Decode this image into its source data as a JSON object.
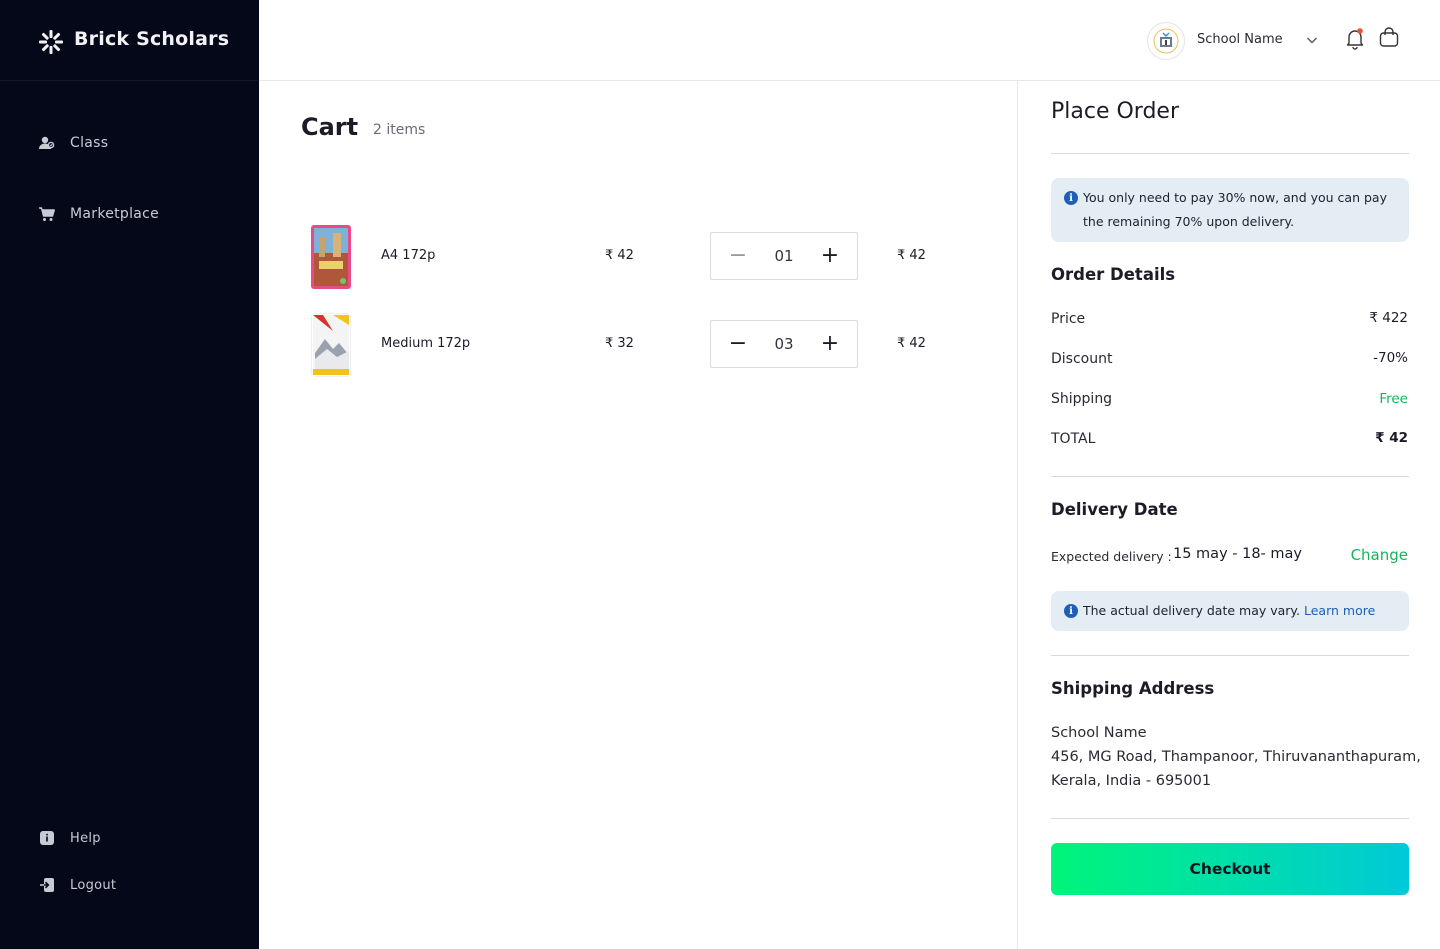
{
  "brand": {
    "name": "Brick Scholars"
  },
  "sidebar": {
    "items": [
      {
        "label": "Class",
        "icon": "users-icon"
      },
      {
        "label": "Marketplace",
        "icon": "cart-icon"
      }
    ],
    "bottom": [
      {
        "label": "Help",
        "icon": "info-icon"
      },
      {
        "label": "Logout",
        "icon": "logout-icon"
      }
    ]
  },
  "header": {
    "school_name": "School Name"
  },
  "cart": {
    "title": "Cart",
    "count_label": "2 items",
    "items": [
      {
        "name": "A4 172p",
        "price": "₹ 42",
        "qty": "01",
        "total": "₹ 42"
      },
      {
        "name": "Medium 172p",
        "price": "₹ 32",
        "qty": "03",
        "total": "₹ 42"
      }
    ]
  },
  "order": {
    "title": "Place Order",
    "pay_note": "You only need to pay 30% now, and you can pay the remaining 70% upon delivery.",
    "details_title": "Order Details",
    "price_label": "Price",
    "price_value": "₹ 422",
    "discount_label": "Discount",
    "discount_value": "-70%",
    "shipping_label": "Shipping",
    "shipping_value": "Free",
    "total_label": "TOTAL",
    "total_value": "₹ 42",
    "delivery_title": "Delivery Date",
    "expected_label": "Expected delivery :",
    "expected_value": "15 may - 18- may",
    "change_label": "Change",
    "delivery_note": "The actual delivery date may vary.",
    "learn_more": "Learn more",
    "address_title": "Shipping Address",
    "address_name": "School Name",
    "address_line1": "456, MG Road, Thampanoor, Thiruvananthapuram,",
    "address_line2": "Kerala, India - 695001",
    "checkout_label": "Checkout"
  },
  "colors": {
    "sidebar_bg": "#050818",
    "accent_green": "#19b35a",
    "link_blue": "#1f5fb8",
    "checkout_from": "#00f57a",
    "checkout_to": "#00c9d8"
  }
}
